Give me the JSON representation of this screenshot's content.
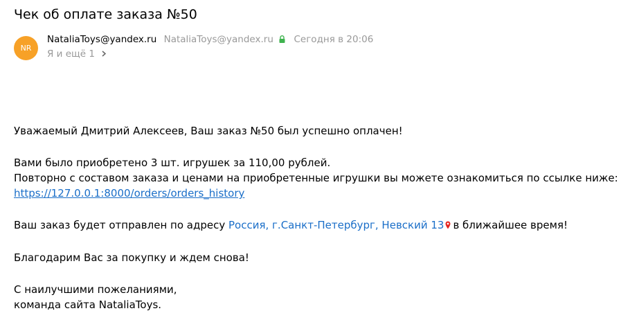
{
  "email": {
    "subject": "Чек об оплате заказа №50",
    "avatar_initials": "NR",
    "sender_name": "NataliaToys@yandex.ru",
    "sender_email": "NataliaToys@yandex.ru",
    "date": "Сегодня в 20:06",
    "recipients": "Я и ещё 1"
  },
  "body": {
    "greeting": "Уважаемый Дмитрий Алексеев, Ваш заказ №50 был успешно оплачен!",
    "purchased": "Вами было приобретено 3 шт. игрушек за 110,00 рублей.",
    "review": "Повторно с составом заказа и ценами на приобретенные игрушки вы можете ознакомиться по ссылке ниже:",
    "link": "https://127.0.0.1:8000/orders/orders_history",
    "shipping_prefix": "Ваш заказ будет отправлен по адресу",
    "address": "Россия, г.Санкт-Петербург, Невский 13",
    "shipping_suffix": "в ближайшее время!",
    "thanks": "Благодарим Вас за покупку и ждем снова!",
    "signoff_1": "С наилучшими пожеланиями,",
    "signoff_2": "команда сайта NataliaToys."
  },
  "colors": {
    "avatar": "#f7a127",
    "link": "#1a6ec8",
    "muted": "#999999",
    "lock": "#3fb34f",
    "pin": "#e52620"
  }
}
